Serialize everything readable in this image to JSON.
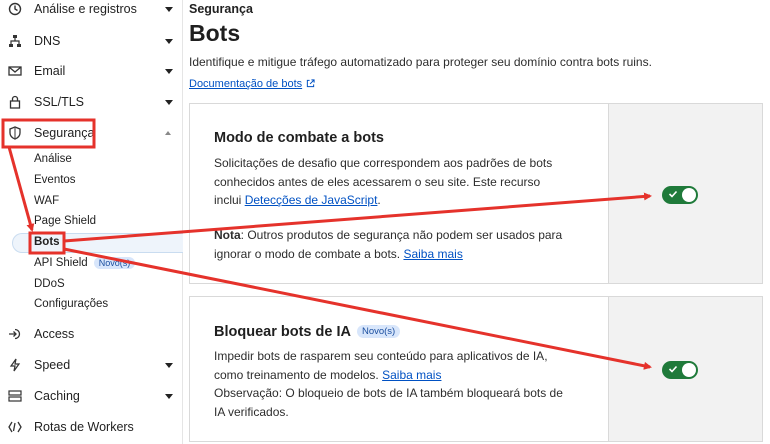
{
  "sidebar": {
    "items": [
      {
        "label": "Análise e registros",
        "icon": "analytics-icon"
      },
      {
        "label": "DNS",
        "icon": "dns-icon"
      },
      {
        "label": "Email",
        "icon": "email-icon"
      },
      {
        "label": "SSL/TLS",
        "icon": "lock-icon"
      },
      {
        "label": "Segurança",
        "icon": "shield-icon"
      },
      {
        "label": "Access",
        "icon": "access-icon"
      },
      {
        "label": "Speed",
        "icon": "lightning-icon"
      },
      {
        "label": "Caching",
        "icon": "caching-icon"
      },
      {
        "label": "Rotas de Workers",
        "icon": "workers-icon"
      }
    ],
    "security_sub": [
      "Análise",
      "Eventos",
      "WAF",
      "Page Shield",
      "Bots",
      "API Shield",
      "DDoS",
      "Configurações"
    ],
    "new_badge": "Novo(s)"
  },
  "main": {
    "breadcrumb": "Segurança",
    "title": "Bots",
    "description": "Identifique e mitigue tráfego automatizado para proteger seu domínio contra bots ruins.",
    "doc_link": "Documentação de bots",
    "card1": {
      "title": "Modo de combate a bots",
      "text_a": "Solicitações de desafio que correspondem aos padrões de bots",
      "text_b": "conhecidos antes de eles acessarem o seu site. Este recurso",
      "text_c": "inclui ",
      "link_js": "Detecções de JavaScript",
      "text_d": ".",
      "note_label": "Nota",
      "note_text_a": ": Outros produtos de segurança não podem ser usados para",
      "note_text_b": "ignorar o modo de combate a bots. ",
      "learn_more": "Saiba mais",
      "toggle_on": true
    },
    "card2": {
      "title": "Bloquear bots de IA",
      "badge": "Novo(s)",
      "text_a": "Impedir bots de rasparem seu conteúdo para aplicativos de IA,",
      "text_b": "como treinamento de modelos. ",
      "learn_more": "Saiba mais",
      "text_c": "Observação: O bloqueio de bots de IA também bloqueará bots de",
      "text_d": "IA verificados.",
      "toggle_on": true
    }
  },
  "colors": {
    "accent_red": "#e5322b",
    "toggle_green": "#1f7a3a",
    "link_blue": "#0051c3"
  }
}
